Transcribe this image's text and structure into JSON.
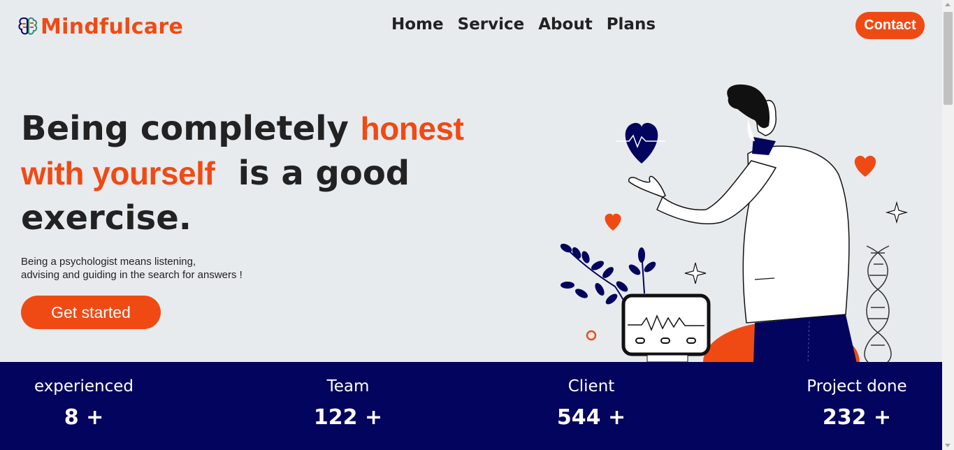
{
  "brand": {
    "name": "Mindfulcare",
    "accent_color": "#f04a14",
    "logo_icon": "brain-icon"
  },
  "nav": {
    "items": [
      "Home",
      "Service",
      "About",
      "Plans"
    ]
  },
  "header": {
    "contact_label": "Contact"
  },
  "hero": {
    "title_part1": "Being completely ",
    "title_accent1": "honest",
    "title_accent2": "with yourself",
    "title_part2": "  is a good exercise.",
    "subtitle_line1": "Being a psychologist means listening,",
    "subtitle_line2": "advising and guiding in the search for answers !",
    "cta_label": "Get started"
  },
  "stats": [
    {
      "label": "experienced",
      "value": "8 +"
    },
    {
      "label": "Team",
      "value": "122 +"
    },
    {
      "label": "Client",
      "value": "544 +"
    },
    {
      "label": "Project done",
      "value": "232 +"
    }
  ],
  "colors": {
    "navy": "#03045e",
    "background": "#e8ebee"
  }
}
